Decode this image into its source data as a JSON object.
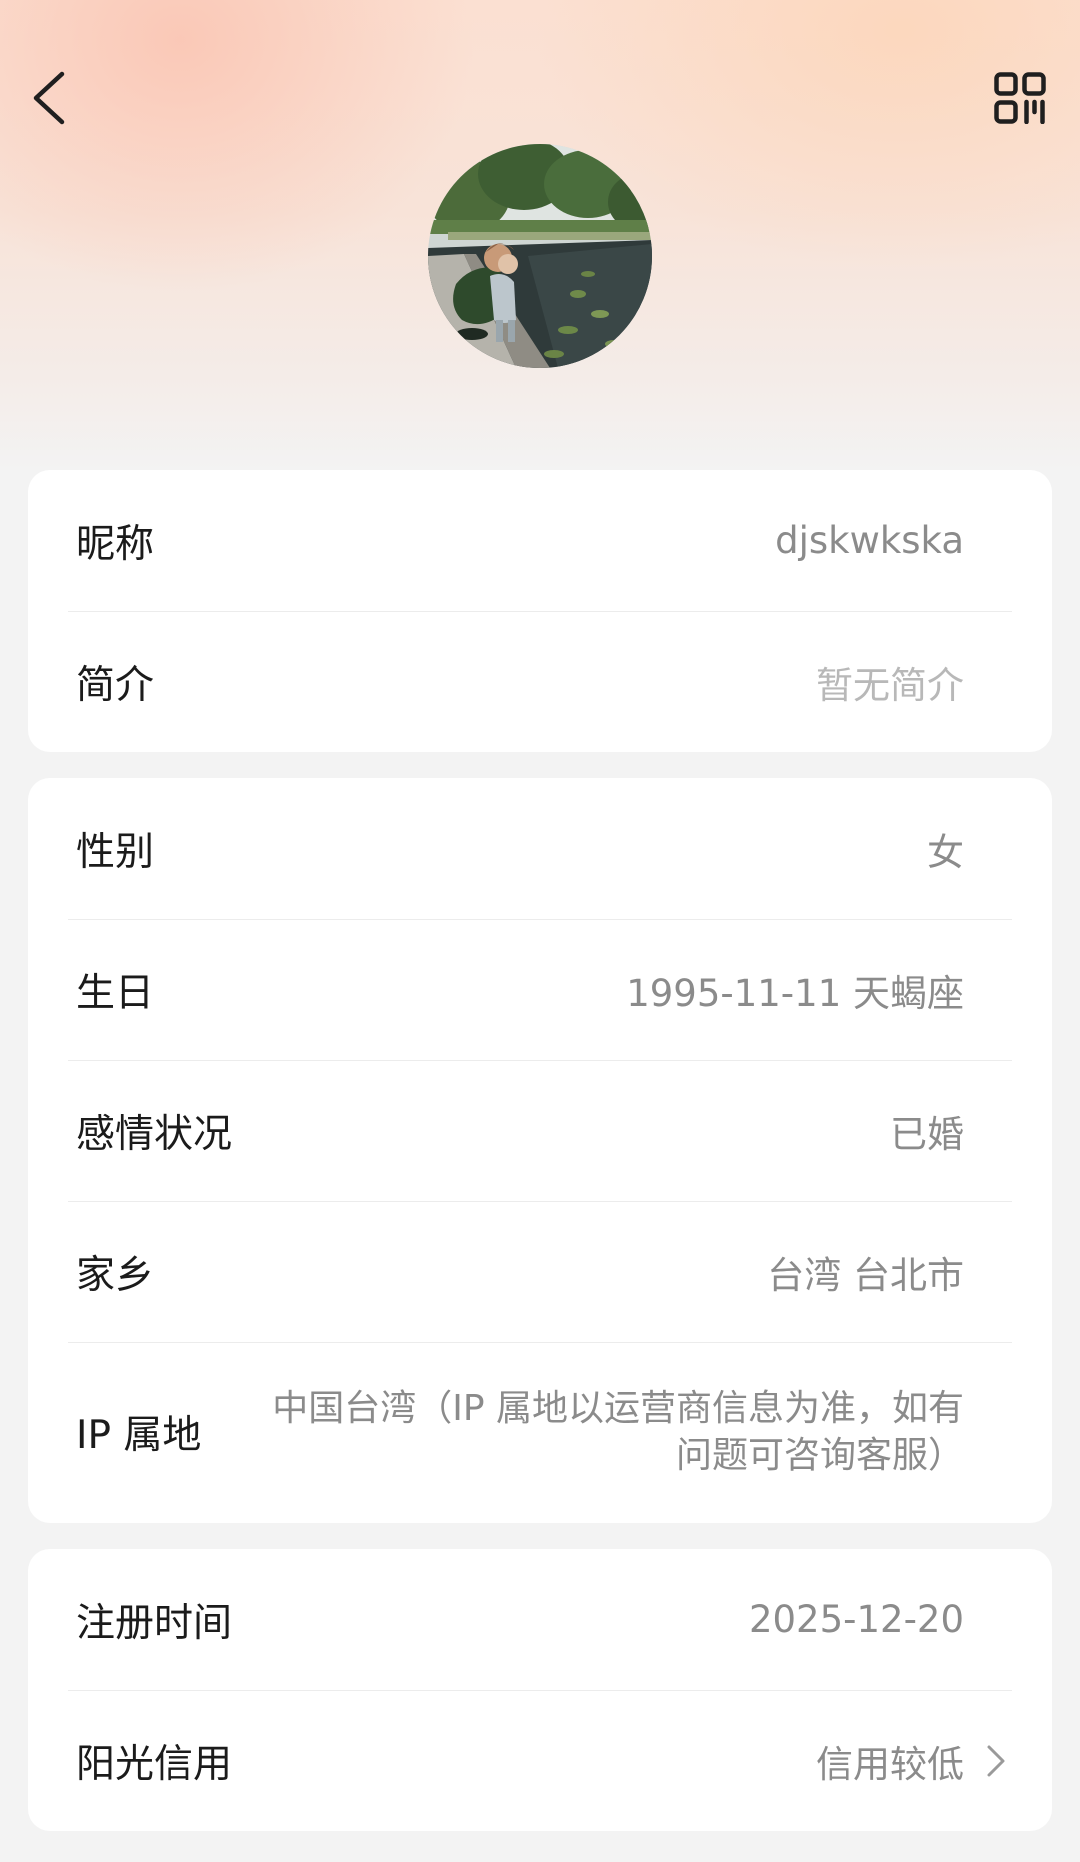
{
  "icons": {
    "back": "chevron-left-icon",
    "qr_code": "qr-code-icon",
    "row_chevron": "chevron-right-icon"
  },
  "colors": {
    "header_gradient_pink": "#fbe0d2",
    "card_background": "#ffffff",
    "page_background": "#f3f3f3",
    "label_text": "#1b1b1b",
    "value_text": "#8b8b8b",
    "placeholder_text": "#b8b8b8"
  },
  "card_basic": {
    "nickname_label": "昵称",
    "nickname_value": "djskwkska",
    "bio_label": "简介",
    "bio_value": "暂无简介"
  },
  "card_details": {
    "gender_label": "性别",
    "gender_value": "女",
    "birthday_label": "生日",
    "birthday_value": "1995-11-11 天蝎座",
    "relationship_label": "感情状况",
    "relationship_value": "已婚",
    "hometown_label": "家乡",
    "hometown_value": "台湾 台北市",
    "ip_label": "IP 属地",
    "ip_value": "中国台湾（IP 属地以运营商信息为准，如有问题可咨询客服）"
  },
  "card_account": {
    "register_label": "注册时间",
    "register_value": "2025-12-20",
    "credit_label": "阳光信用",
    "credit_value": "信用较低"
  }
}
